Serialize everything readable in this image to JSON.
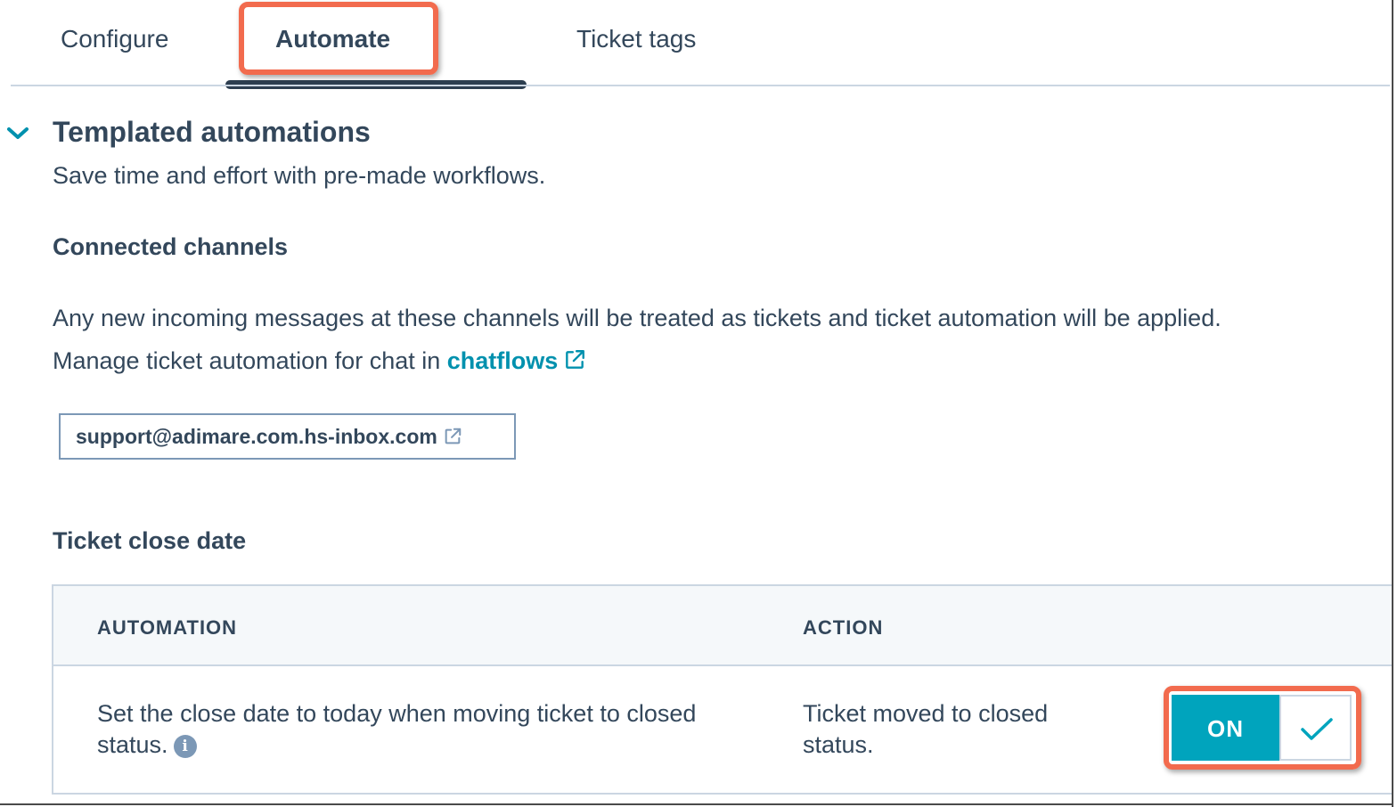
{
  "tabs": [
    {
      "label": "Configure"
    },
    {
      "label": "Automate",
      "active": true
    },
    {
      "label": "Ticket tags"
    }
  ],
  "section": {
    "title": "Templated automations",
    "subtitle": "Save time and effort with pre-made workflows.",
    "expanded": true
  },
  "connected_channels": {
    "heading": "Connected channels",
    "description": "Any new incoming messages at these channels will be treated as tickets and ticket automation will be applied.",
    "manage_prefix": "Manage ticket automation for chat in ",
    "manage_link": "chatflows",
    "channel": "support@adimare.com.hs-inbox.com"
  },
  "ticket_close_date": {
    "heading": "Ticket close date",
    "columns": [
      "AUTOMATION",
      "ACTION"
    ],
    "rows": [
      {
        "automation": "Set the close date to today when moving ticket to closed status.",
        "action": "Ticket moved to closed status.",
        "toggle_label": "ON",
        "enabled": true
      }
    ]
  },
  "icons": {
    "chevron": "chevron-down-icon",
    "external_link": "external-link-icon",
    "info": "info-icon",
    "check": "checkmark-icon"
  },
  "colors": {
    "text": "#33475b",
    "link": "#0091ae",
    "toggle_on": "#00a4bd",
    "highlight": "#f26b4e",
    "tab_indicator": "#2d3e50"
  }
}
